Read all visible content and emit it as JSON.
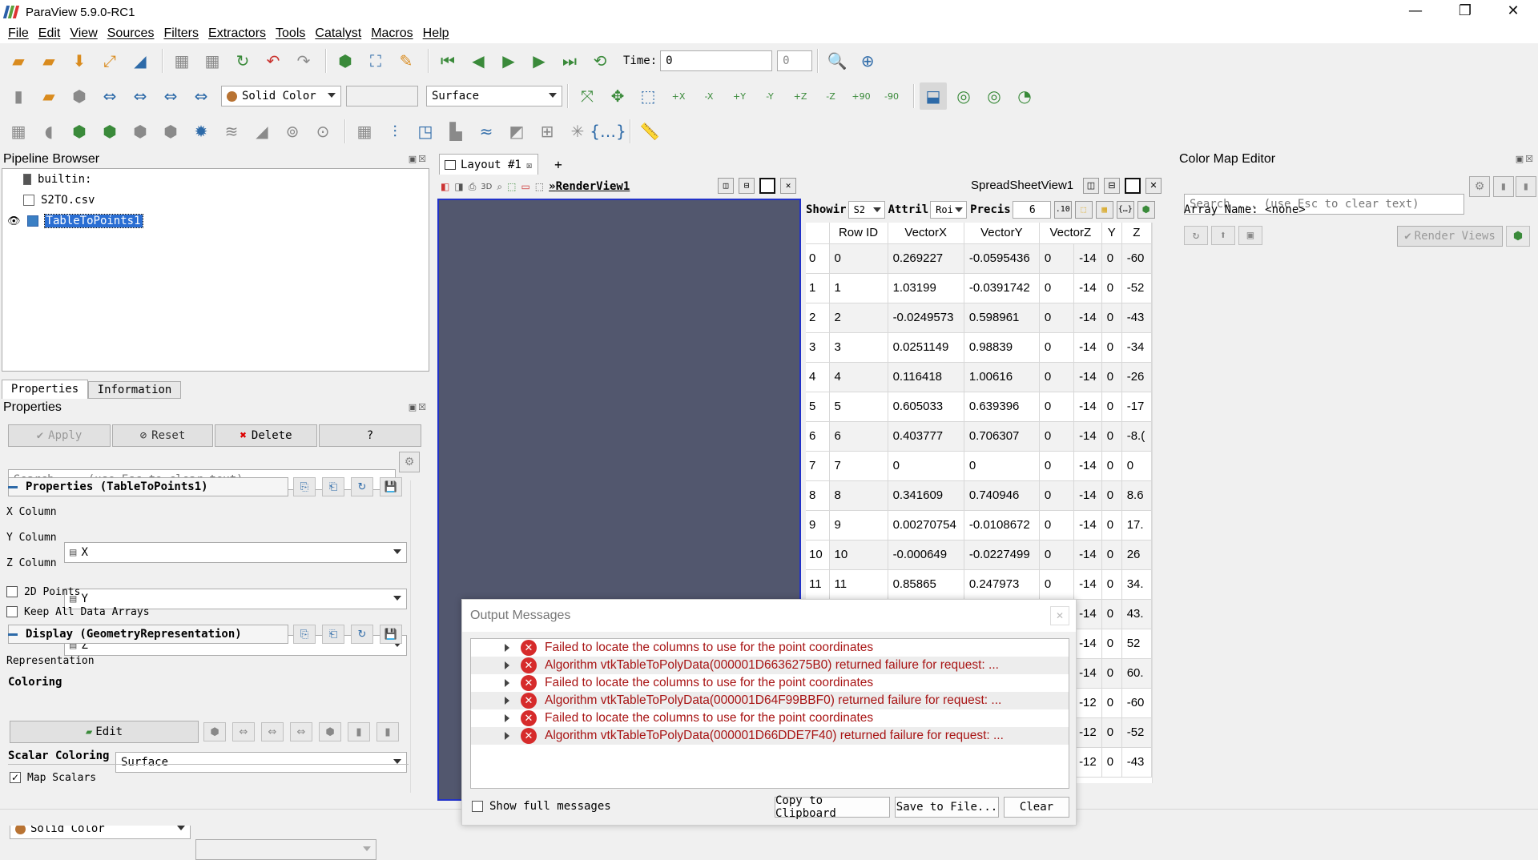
{
  "window": {
    "title": "ParaView 5.9.0-RC1",
    "minimize": "—",
    "maximize": "❐",
    "close": "✕"
  },
  "menu": [
    "File",
    "Edit",
    "View",
    "Sources",
    "Filters",
    "Extractors",
    "Tools",
    "Catalyst",
    "Macros",
    "Help"
  ],
  "toolbar": {
    "time_label": "Time:",
    "time_value": "0",
    "time_index": "0",
    "color_by": "Solid Color",
    "color_component": "",
    "representation": "Surface",
    "view_axis_labels": [
      "+X",
      "-X",
      "+Y",
      "-Y",
      "+Z",
      "-Z"
    ],
    "rot_labels": [
      "+90",
      "-90"
    ]
  },
  "pipeline": {
    "title": "Pipeline Browser",
    "items": [
      "builtin:",
      "S2TO.csv",
      "TableToPoints1"
    ]
  },
  "properties": {
    "tabs": [
      "Properties",
      "Information"
    ],
    "title": "Properties",
    "apply": "Apply",
    "reset": "Reset",
    "delete": "Delete",
    "help": "?",
    "search_placeholder": "Search ... (use Esc to clear text)",
    "section_props": "Properties (TableToPoints1)",
    "x_column_label": "X Column",
    "x_column_value": "X",
    "y_column_label": "Y Column",
    "y_column_value": "Y",
    "z_column_label": "Z Column",
    "z_column_value": "Z",
    "points_2d": "2D Points",
    "keep_all": "Keep All Data Arrays",
    "section_display": "Display (GeometryRepresentation)",
    "representation_label": "Representation",
    "representation_value": "Surface",
    "coloring_label": "Coloring",
    "coloring_value": "Solid Color",
    "edit": "Edit",
    "scalar_coloring": "Scalar Coloring",
    "map_scalars": "Map Scalars"
  },
  "layout": {
    "tab": "Layout #1",
    "add": "+"
  },
  "render_view": {
    "label": "RenderView1",
    "mode": "3D",
    "bg": "#52576e"
  },
  "spreadsheet": {
    "label": "SpreadSheetView1",
    "showing_label": "Showir",
    "showing_value": "S2",
    "attribute_label": "Attril",
    "attribute_value": "Roi",
    "precision_label": "Precis",
    "precision_value": "6",
    "columns": [
      "Row ID",
      "VectorX",
      "VectorY",
      "VectorZ",
      "Y",
      "Z"
    ],
    "rows": [
      [
        "0",
        "0",
        "0.269227",
        "-0.0595436",
        "0",
        "-14",
        "0",
        "-60"
      ],
      [
        "1",
        "1",
        "1.03199",
        "-0.0391742",
        "0",
        "-14",
        "0",
        "-52"
      ],
      [
        "2",
        "2",
        "-0.0249573",
        "0.598961",
        "0",
        "-14",
        "0",
        "-43"
      ],
      [
        "3",
        "3",
        "0.0251149",
        "0.98839",
        "0",
        "-14",
        "0",
        "-34"
      ],
      [
        "4",
        "4",
        "0.116418",
        "1.00616",
        "0",
        "-14",
        "0",
        "-26"
      ],
      [
        "5",
        "5",
        "0.605033",
        "0.639396",
        "0",
        "-14",
        "0",
        "-17"
      ],
      [
        "6",
        "6",
        "0.403777",
        "0.706307",
        "0",
        "-14",
        "0",
        "-8.("
      ],
      [
        "7",
        "7",
        "0",
        "0",
        "0",
        "-14",
        "0",
        "0"
      ],
      [
        "8",
        "8",
        "0.341609",
        "0.740946",
        "0",
        "-14",
        "0",
        "8.6"
      ],
      [
        "9",
        "9",
        "0.00270754",
        "-0.0108672",
        "0",
        "-14",
        "0",
        "17."
      ],
      [
        "10",
        "10",
        "-0.000649",
        "-0.0227499",
        "0",
        "-14",
        "0",
        "26"
      ],
      [
        "11",
        "11",
        "0.85865",
        "0.247973",
        "0",
        "-14",
        "0",
        "34."
      ],
      [
        "",
        "",
        "",
        "",
        "",
        "-14",
        "0",
        "43."
      ],
      [
        "",
        "",
        "",
        "",
        "",
        "-14",
        "0",
        "52"
      ],
      [
        "",
        "",
        "",
        "",
        "",
        "-14",
        "0",
        "60."
      ],
      [
        "",
        "",
        "",
        "",
        "",
        "-12",
        "0",
        "-60"
      ],
      [
        "",
        "",
        "",
        "",
        "",
        "-12",
        "0",
        "-52"
      ],
      [
        "",
        "",
        "",
        "",
        "",
        "-12",
        "0",
        "-43"
      ]
    ]
  },
  "colormap": {
    "title": "Color Map Editor",
    "search_placeholder": "Search ... (use Esc to clear text)",
    "array_name": "Array Name: <none>",
    "render_views": "Render Views"
  },
  "output": {
    "title": "Output Messages",
    "messages": [
      "Failed to locate the columns to use for the point coordinates",
      "Algorithm vtkTableToPolyData(000001D6636275B0) returned failure for request: ...",
      "Failed to locate the columns to use for the point coordinates",
      "Algorithm vtkTableToPolyData(000001D64F99BBF0) returned failure for request: ...",
      "Failed to locate the columns to use for the point coordinates",
      "Algorithm vtkTableToPolyData(000001D66DDE7F40) returned failure for request: ..."
    ],
    "show_full": "Show full messages",
    "copy": "Copy to Clipboard",
    "save": "Save to File...",
    "clear": "Clear"
  }
}
